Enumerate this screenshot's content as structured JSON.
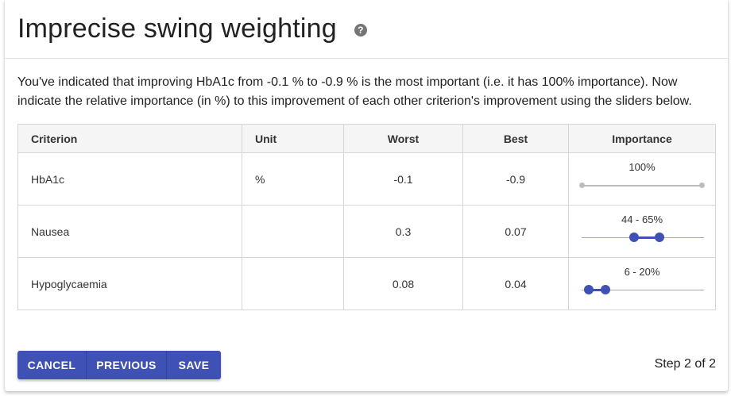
{
  "dialog": {
    "title": "Imprecise swing weighting",
    "help_icon": "question-mark-icon",
    "instructions": "You've indicated that improving HbA1c from -0.1 % to -0.9 % is the most important (i.e. it has 100% importance). Now indicate the relative importance (in %) to this improvement of each other criterion's improvement using the sliders below."
  },
  "table": {
    "headers": {
      "criterion": "Criterion",
      "unit": "Unit",
      "worst": "Worst",
      "best": "Best",
      "importance": "Importance"
    },
    "rows": [
      {
        "criterion": "HbA1c",
        "unit": "%",
        "worst": "-0.1",
        "best": "-0.9",
        "importance_label": "100%",
        "range": [
          100,
          100
        ],
        "disabled": true
      },
      {
        "criterion": "Nausea",
        "unit": "",
        "worst": "0.3",
        "best": "0.07",
        "importance_label": "44 - 65%",
        "range": [
          44,
          65
        ],
        "disabled": false
      },
      {
        "criterion": "Hypoglycaemia",
        "unit": "",
        "worst": "0.08",
        "best": "0.04",
        "importance_label": "6 - 20%",
        "range": [
          6,
          20
        ],
        "disabled": false
      }
    ]
  },
  "footer": {
    "cancel_label": "CANCEL",
    "previous_label": "PREVIOUS",
    "save_label": "SAVE",
    "step_text": "Step 2 of 2"
  },
  "colors": {
    "primary": "#3f51b5",
    "track_light": "#9fa8da",
    "disabled": "#bdbdbd"
  }
}
